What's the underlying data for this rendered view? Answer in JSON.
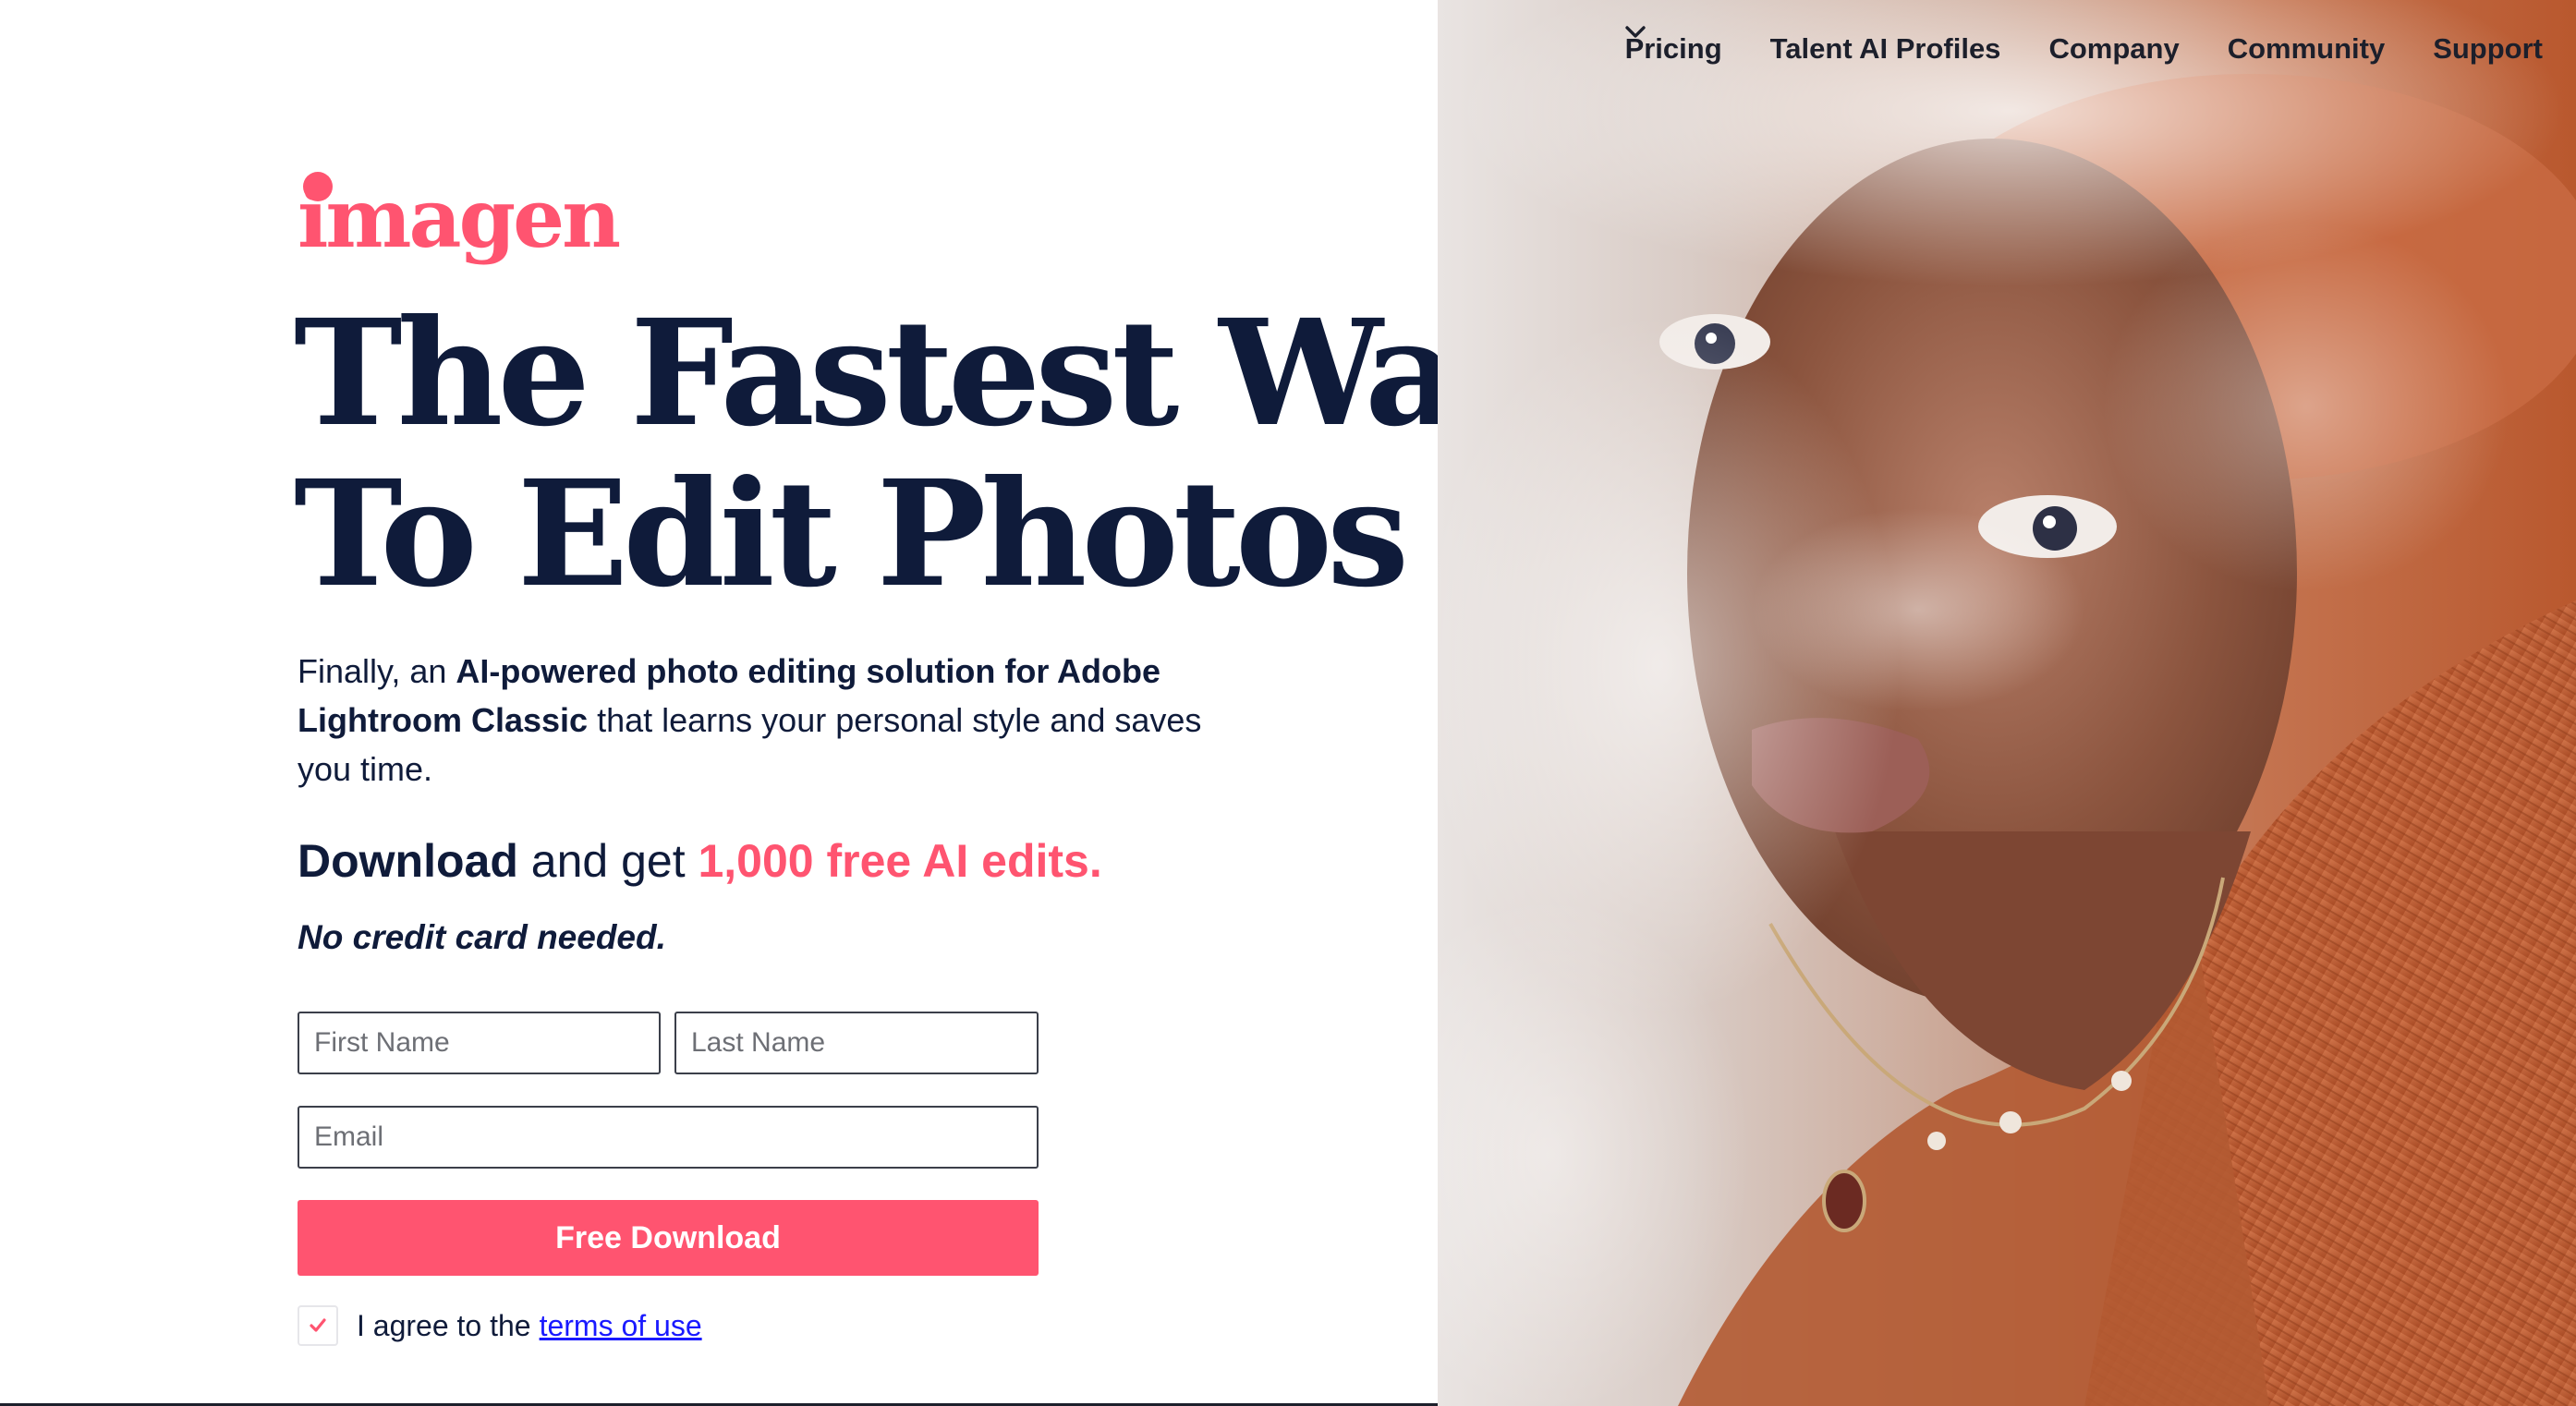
{
  "brand": {
    "logo_text": "imagen",
    "accent_color": "#ff5470",
    "text_color": "#0f1b3a"
  },
  "nav": {
    "items": [
      {
        "label": "Pricing",
        "has_dropdown": false
      },
      {
        "label": "Talent AI Profiles",
        "has_dropdown": false
      },
      {
        "label": "Company",
        "has_dropdown": true
      },
      {
        "label": "Community",
        "has_dropdown": true
      },
      {
        "label": "Support",
        "has_dropdown": false
      }
    ]
  },
  "hero": {
    "headline_line1": "The Fastest Way",
    "headline_line2": "To Edit Photos",
    "intro_prefix": "Finally, an ",
    "intro_bold": "AI-powered photo editing solution for Adobe Lightroom Classic",
    "intro_suffix": " that learns your personal style and saves you time.",
    "offer_bold": "Download",
    "offer_middle": " and get ",
    "offer_highlight": "1,000 free AI edits.",
    "no_card": "No credit card needed."
  },
  "form": {
    "first_name_placeholder": "First Name",
    "last_name_placeholder": "Last Name",
    "email_placeholder": "Email",
    "submit_label": "Free Download",
    "agree_text": "I agree to the",
    "terms_link": "terms of use",
    "agree_checked": true
  },
  "icons": {
    "dropdown": "chevron-down-icon",
    "checkbox": "checkmark-icon"
  }
}
